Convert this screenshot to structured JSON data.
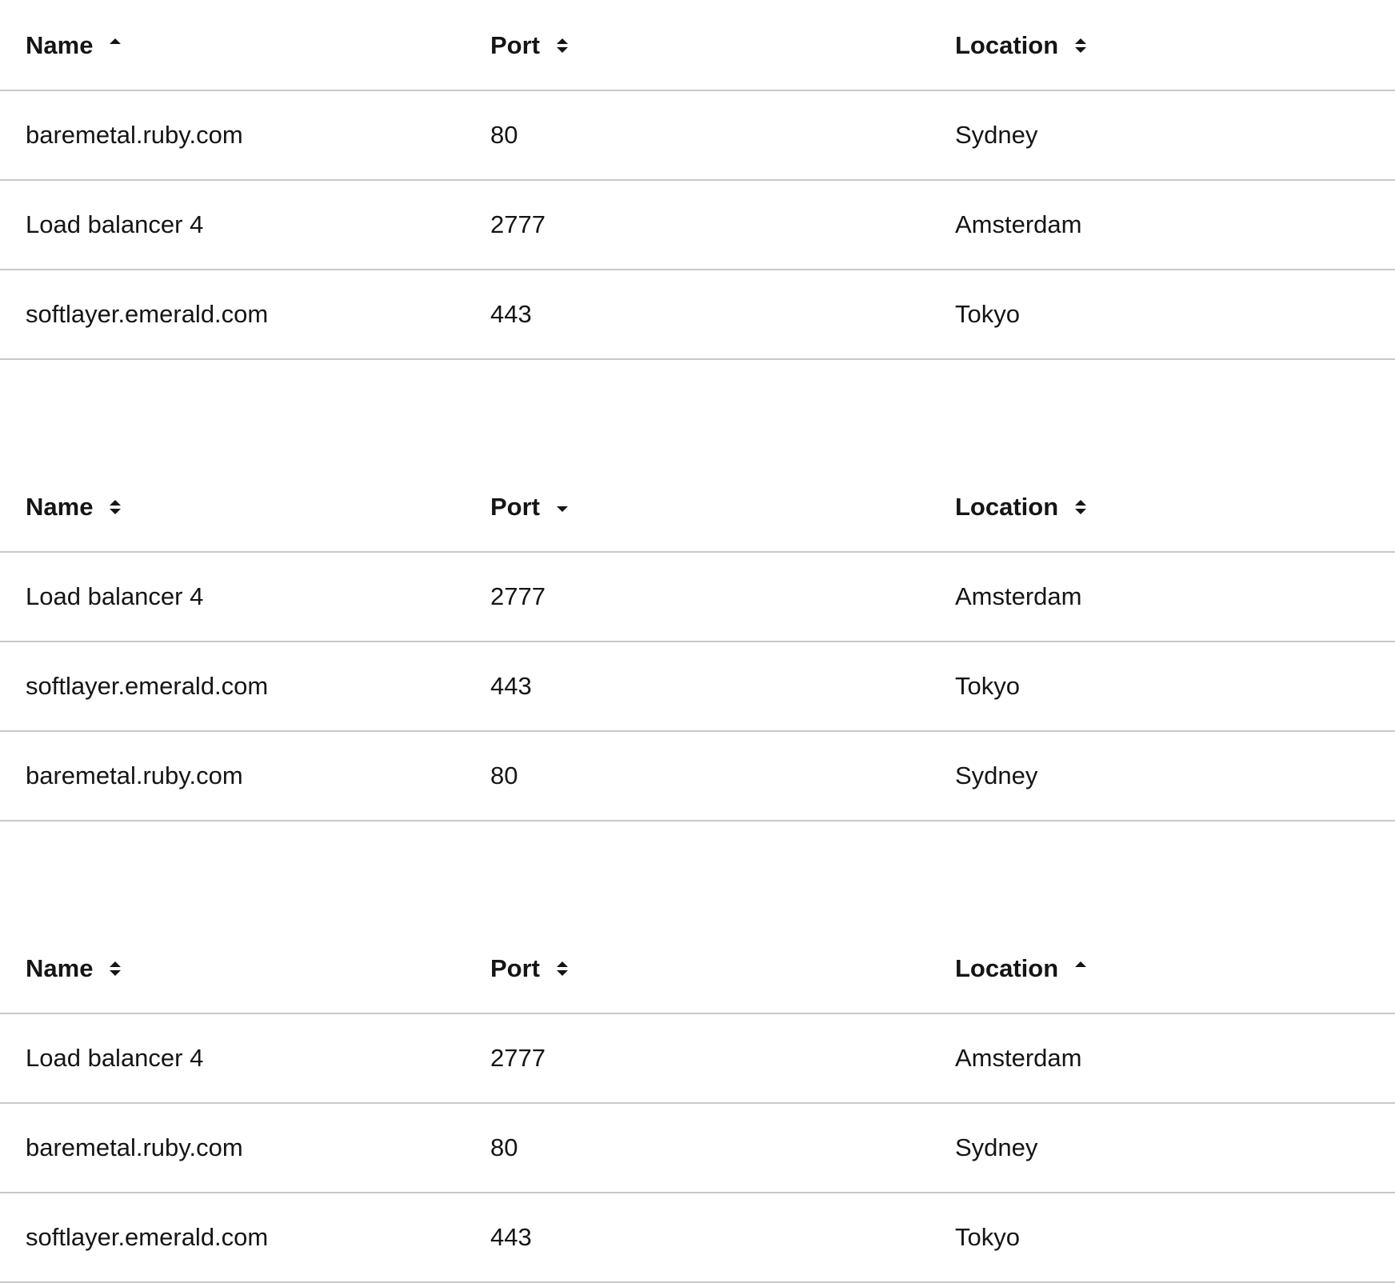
{
  "tables": [
    {
      "headers": [
        {
          "label": "Name",
          "sort": "asc"
        },
        {
          "label": "Port",
          "sort": "none"
        },
        {
          "label": "Location",
          "sort": "none"
        }
      ],
      "rows": [
        [
          "baremetal.ruby.com",
          "80",
          "Sydney"
        ],
        [
          "Load balancer 4",
          "2777",
          "Amsterdam"
        ],
        [
          "softlayer.emerald.com",
          "443",
          "Tokyo"
        ]
      ]
    },
    {
      "headers": [
        {
          "label": "Name",
          "sort": "none"
        },
        {
          "label": "Port",
          "sort": "desc"
        },
        {
          "label": "Location",
          "sort": "none"
        }
      ],
      "rows": [
        [
          "Load balancer 4",
          "2777",
          "Amsterdam"
        ],
        [
          "softlayer.emerald.com",
          "443",
          "Tokyo"
        ],
        [
          "baremetal.ruby.com",
          "80",
          "Sydney"
        ]
      ]
    },
    {
      "headers": [
        {
          "label": "Name",
          "sort": "none"
        },
        {
          "label": "Port",
          "sort": "none"
        },
        {
          "label": "Location",
          "sort": "asc"
        }
      ],
      "rows": [
        [
          "Load balancer 4",
          "2777",
          "Amsterdam"
        ],
        [
          "baremetal.ruby.com",
          "80",
          "Sydney"
        ],
        [
          "softlayer.emerald.com",
          "443",
          "Tokyo"
        ]
      ]
    }
  ]
}
